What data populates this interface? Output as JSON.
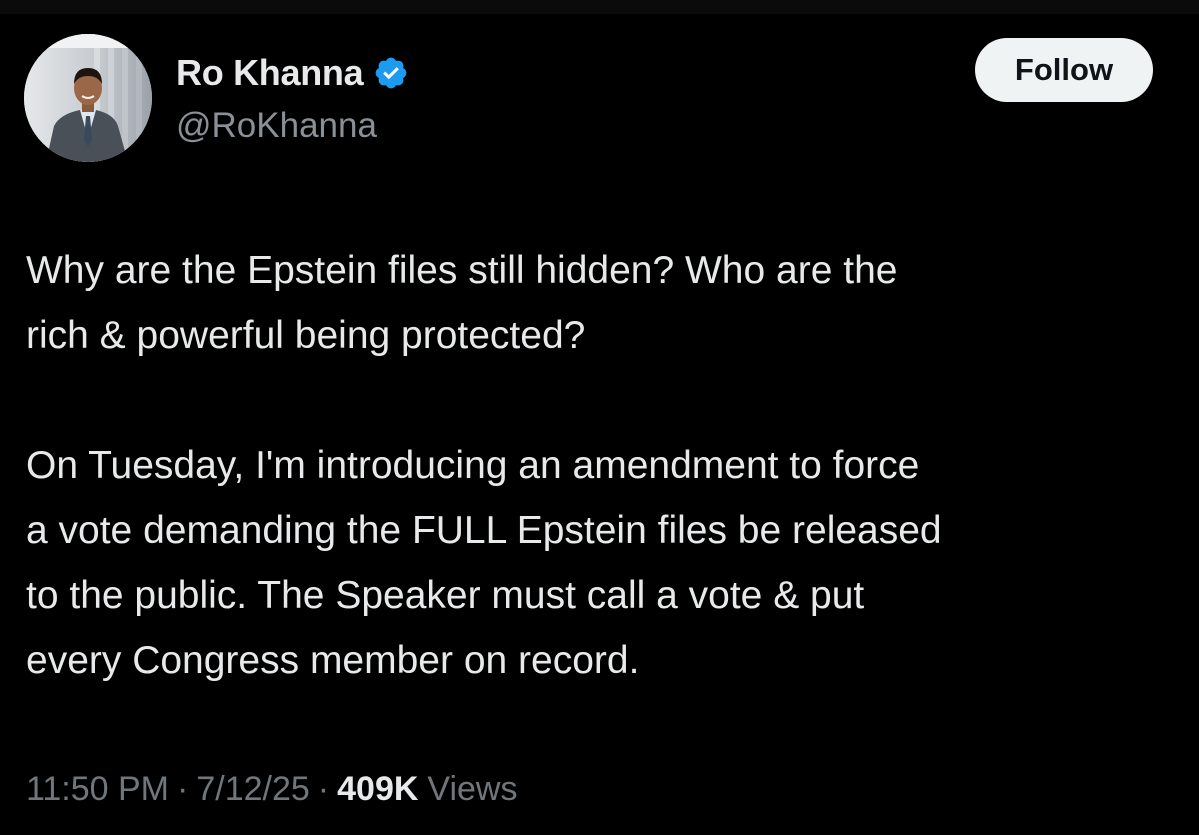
{
  "author": {
    "display_name": "Ro Khanna",
    "handle": "@RoKhanna",
    "avatar_icon": "profile-photo",
    "verified_icon": "verified-badge-icon",
    "verified_color": "#1d9bf0"
  },
  "follow_button": {
    "label": "Follow"
  },
  "tweet": {
    "paragraph_1": [
      "Why are the Epstein files still hidden? Who are the",
      "rich & powerful being protected?"
    ],
    "paragraph_2": [
      "On Tuesday, I'm introducing an amendment to force",
      "a vote demanding the FULL Epstein files be released",
      "to the public. The Speaker must call a vote & put",
      "every Congress member on record."
    ]
  },
  "meta": {
    "time": "11:50 PM",
    "separator": "·",
    "date": "7/12/25",
    "views_count": "409K",
    "views_label": "Views"
  },
  "colors": {
    "background": "#000000",
    "primary_text": "#e7e9ea",
    "secondary_text": "#71767b",
    "button_bg": "#eff3f4",
    "button_text": "#0f1419"
  }
}
